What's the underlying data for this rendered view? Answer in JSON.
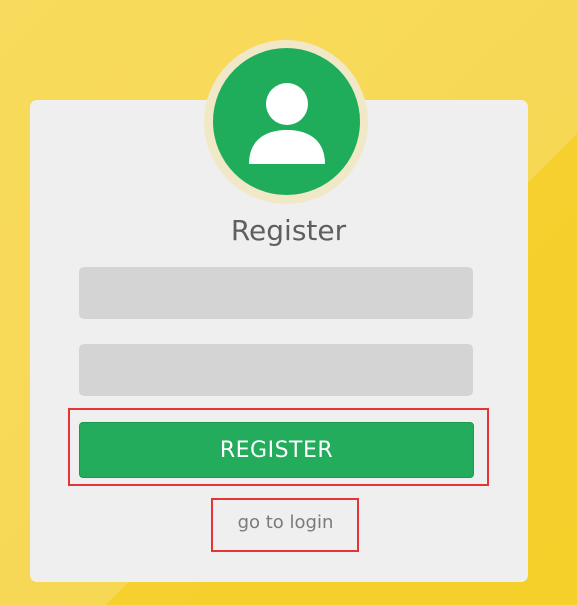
{
  "form": {
    "title": "Register",
    "fields": [
      {
        "value": "",
        "placeholder": ""
      },
      {
        "value": "",
        "placeholder": ""
      }
    ],
    "register_label": "REGISTER",
    "login_link_label": "go to login"
  },
  "icons": {
    "avatar": "user-icon"
  },
  "colors": {
    "background": "#f7d85a",
    "card": "#efefef",
    "accent": "#22ac5b",
    "highlight": "#e53438"
  }
}
